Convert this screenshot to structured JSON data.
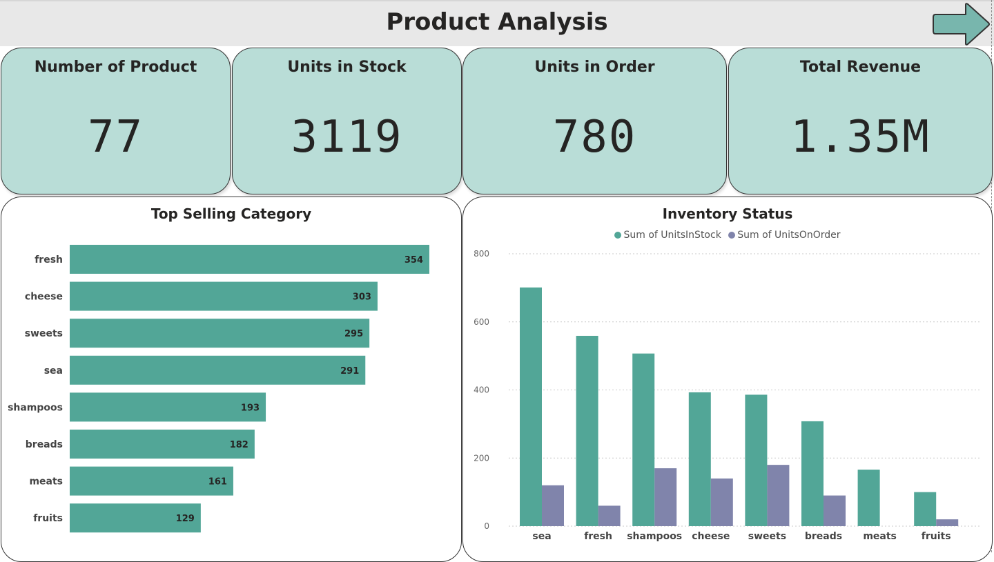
{
  "header": {
    "title": "Product Analysis"
  },
  "kpis": [
    {
      "label": "Number of Product",
      "value": "77"
    },
    {
      "label": "Units in Stock",
      "value": "3119"
    },
    {
      "label": "Units in Order",
      "value": "780"
    },
    {
      "label": "Total Revenue",
      "value": "1.35M"
    }
  ],
  "colors": {
    "teal": "#52a697",
    "purple": "#8084ab",
    "card": "#b9ddd7",
    "arrow": "#78b6ad"
  },
  "chart_data": [
    {
      "type": "bar",
      "orientation": "horizontal",
      "title": "Top Selling Category",
      "categories": [
        "fresh",
        "cheese",
        "sweets",
        "sea",
        "shampoos",
        "breads",
        "meats",
        "fruits"
      ],
      "values": [
        354,
        303,
        295,
        291,
        193,
        182,
        161,
        129
      ],
      "xlim": [
        0,
        354
      ],
      "grid": false,
      "color": "#52a697"
    },
    {
      "type": "bar",
      "title": "Inventory Status",
      "categories": [
        "sea",
        "fresh",
        "shampoos",
        "cheese",
        "sweets",
        "breads",
        "meats",
        "fruits"
      ],
      "series": [
        {
          "name": "Sum of UnitsInStock",
          "values": [
            701,
            559,
            507,
            393,
            386,
            308,
            166,
            100
          ],
          "color": "#52a697"
        },
        {
          "name": "Sum of UnitsOnOrder",
          "values": [
            120,
            60,
            170,
            140,
            180,
            90,
            0,
            20
          ],
          "color": "#8084ab"
        }
      ],
      "ylim": [
        0,
        800
      ],
      "yticks": [
        0,
        200,
        400,
        600,
        800
      ],
      "grid": true,
      "legend": "top-center"
    }
  ]
}
